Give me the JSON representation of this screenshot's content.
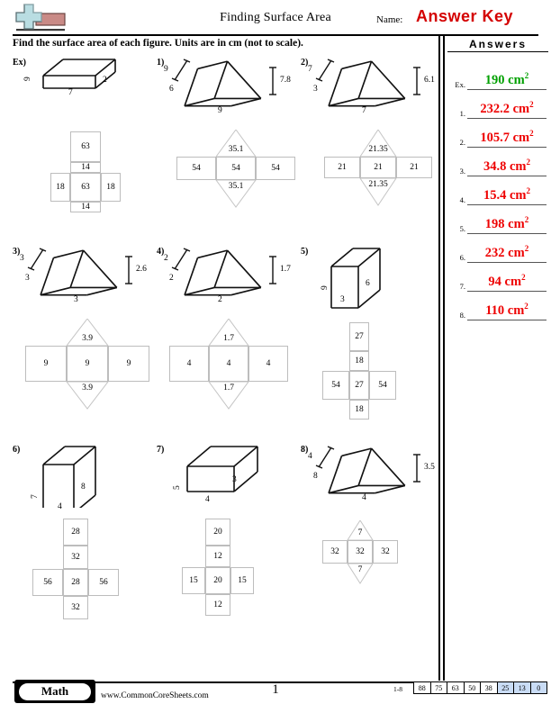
{
  "header": {
    "title": "Finding Surface Area",
    "name_label": "Name:",
    "answer_key": "Answer Key",
    "instructions": "Find the surface area of each figure. Units are in cm (not to scale).",
    "logo_icon": "plus-block-logo"
  },
  "answers_panel": {
    "heading": "Answers",
    "rows": [
      {
        "num": "Ex.",
        "value": "190 cm",
        "exp": "2",
        "color": "#00a000"
      },
      {
        "num": "1.",
        "value": "232.2 cm",
        "exp": "2",
        "color": "#ee0000"
      },
      {
        "num": "2.",
        "value": "105.7 cm",
        "exp": "2",
        "color": "#ee0000"
      },
      {
        "num": "3.",
        "value": "34.8 cm",
        "exp": "2",
        "color": "#ee0000"
      },
      {
        "num": "4.",
        "value": "15.4 cm",
        "exp": "2",
        "color": "#ee0000"
      },
      {
        "num": "5.",
        "value": "198 cm",
        "exp": "2",
        "color": "#ee0000"
      },
      {
        "num": "6.",
        "value": "232 cm",
        "exp": "2",
        "color": "#ee0000"
      },
      {
        "num": "7.",
        "value": "94 cm",
        "exp": "2",
        "color": "#ee0000"
      },
      {
        "num": "8.",
        "value": "110 cm",
        "exp": "2",
        "color": "#ee0000"
      }
    ]
  },
  "problems": [
    {
      "id": "ex",
      "label": "Ex)",
      "shape": "rectangular-prism",
      "dims": {
        "depth": "9",
        "width": "7",
        "height": "2"
      },
      "net": {
        "top": "63",
        "upper": "14",
        "left": "18",
        "center": "63",
        "right": "18",
        "lower": "14"
      }
    },
    {
      "id": "p1",
      "label": "1)",
      "shape": "triangular-prism",
      "dims": {
        "slant": "9",
        "side": "6",
        "base": "9",
        "height": "7.8"
      },
      "net": {
        "top_tri": "35.1",
        "left": "54",
        "center": "54",
        "right": "54",
        "bottom_tri": "35.1"
      }
    },
    {
      "id": "p2",
      "label": "2)",
      "shape": "triangular-prism",
      "dims": {
        "slant": "7",
        "side": "3",
        "base": "7",
        "height": "6.1"
      },
      "net": {
        "top_tri": "21.35",
        "left": "21",
        "center": "21",
        "right": "21",
        "bottom_tri": "21.35"
      }
    },
    {
      "id": "p3",
      "label": "3)",
      "shape": "triangular-prism",
      "dims": {
        "slant": "3",
        "side": "3",
        "base": "3",
        "height": "2.6"
      },
      "net": {
        "top_tri": "3.9",
        "left": "9",
        "center": "9",
        "right": "9",
        "bottom_tri": "3.9"
      }
    },
    {
      "id": "p4",
      "label": "4)",
      "shape": "triangular-prism",
      "dims": {
        "slant": "2",
        "side": "2",
        "base": "2",
        "height": "1.7"
      },
      "net": {
        "top_tri": "1.7",
        "left": "4",
        "center": "4",
        "right": "4",
        "bottom_tri": "1.7"
      }
    },
    {
      "id": "p5",
      "label": "5)",
      "shape": "rectangular-prism",
      "dims": {
        "depth": "9",
        "width": "3",
        "height": "6"
      },
      "net": {
        "top": "27",
        "upper": "18",
        "left": "54",
        "center": "27",
        "right": "54",
        "lower": "18"
      }
    },
    {
      "id": "p6",
      "label": "6)",
      "shape": "rectangular-prism",
      "dims": {
        "depth": "7",
        "width": "4",
        "height": "8"
      },
      "net": {
        "top": "28",
        "upper": "32",
        "left": "56",
        "center": "28",
        "right": "56",
        "lower": "32"
      }
    },
    {
      "id": "p7",
      "label": "7)",
      "shape": "rectangular-prism",
      "dims": {
        "depth": "5",
        "width": "4",
        "height": "3"
      },
      "net": {
        "top": "20",
        "upper": "12",
        "left": "15",
        "center": "20",
        "right": "15",
        "lower": "12"
      }
    },
    {
      "id": "p8",
      "label": "8)",
      "shape": "triangular-prism",
      "dims": {
        "slant": "4",
        "side": "8",
        "base": "4",
        "height": "3.5"
      },
      "net": {
        "top_tri": "7",
        "left": "32",
        "center": "32",
        "right": "32",
        "bottom_tri": "7"
      }
    }
  ],
  "footer": {
    "math_badge": "Math",
    "site": "www.CommonCoreSheets.com",
    "page_number": "1",
    "score_label": "1-8",
    "score_values": [
      "88",
      "75",
      "63",
      "50",
      "38",
      "25",
      "13",
      "0"
    ],
    "highlighted_scores": [
      "25",
      "13",
      "0"
    ],
    "highlight_color": "#c9dcf5"
  }
}
